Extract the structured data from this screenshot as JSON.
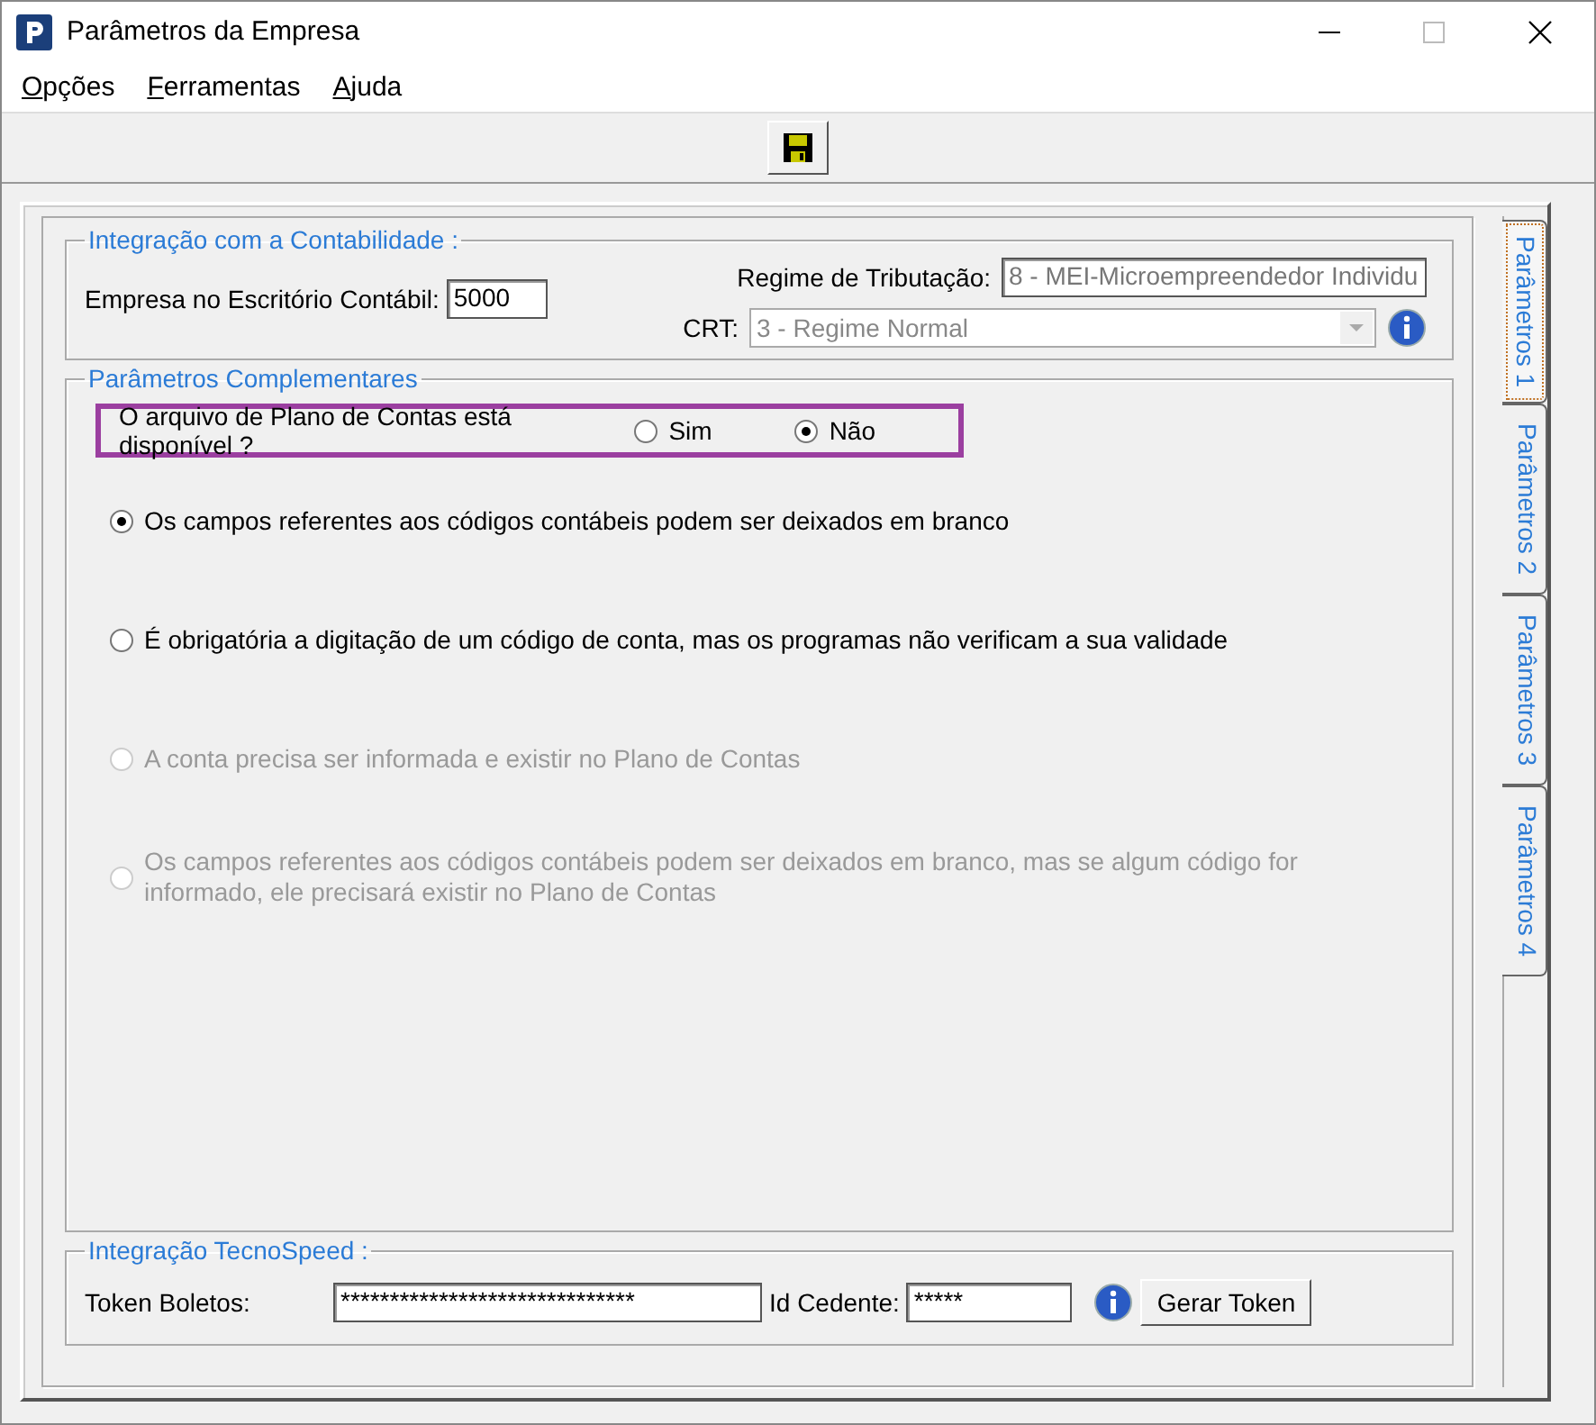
{
  "window": {
    "title": "Parâmetros da Empresa"
  },
  "menu": [
    "Opções",
    "Ferramentas",
    "Ajuda"
  ],
  "accounting": {
    "legend": "Integração com a Contabilidade :",
    "company_label": "Empresa no Escritório Contábil:",
    "company_value": "5000",
    "regime_label": "Regime de Tributação:",
    "regime_value": "8 - MEI-Microempreendedor Individu",
    "crt_label": "CRT:",
    "crt_value": "3 - Regime Normal",
    "crt_disabled": true
  },
  "complementary": {
    "legend": "Parâmetros Complementares",
    "question": "O arquivo de Plano de Contas está disponível ?",
    "answers": [
      {
        "label": "Sim",
        "selected": false
      },
      {
        "label": "Não",
        "selected": true
      }
    ],
    "options": [
      {
        "label": "Os campos referentes aos códigos contábeis podem ser deixados em branco",
        "selected": true,
        "disabled": false
      },
      {
        "label": "É obrigatória a digitação de um código de conta, mas os programas não verificam a sua validade",
        "selected": false,
        "disabled": false
      },
      {
        "label": "A conta precisa ser informada e existir no Plano de Contas",
        "selected": false,
        "disabled": true
      },
      {
        "label": "Os campos referentes aos códigos contábeis podem ser deixados em branco, mas se algum código for informado, ele precisará existir no Plano de Contas",
        "selected": false,
        "disabled": true
      }
    ]
  },
  "tecnospeed": {
    "legend": "Integração TecnoSpeed :",
    "token_label": "Token Boletos:",
    "token_value": "******************************",
    "cedente_label": "Id Cedente:",
    "cedente_value": "*****",
    "button": "Gerar Token"
  },
  "tabs": [
    {
      "label": "Parâmetros 1",
      "selected": true
    },
    {
      "label": "Parâmetros 2",
      "selected": false
    },
    {
      "label": "Parâmetros 3",
      "selected": false
    },
    {
      "label": "Parâmetros 4",
      "selected": false
    }
  ]
}
